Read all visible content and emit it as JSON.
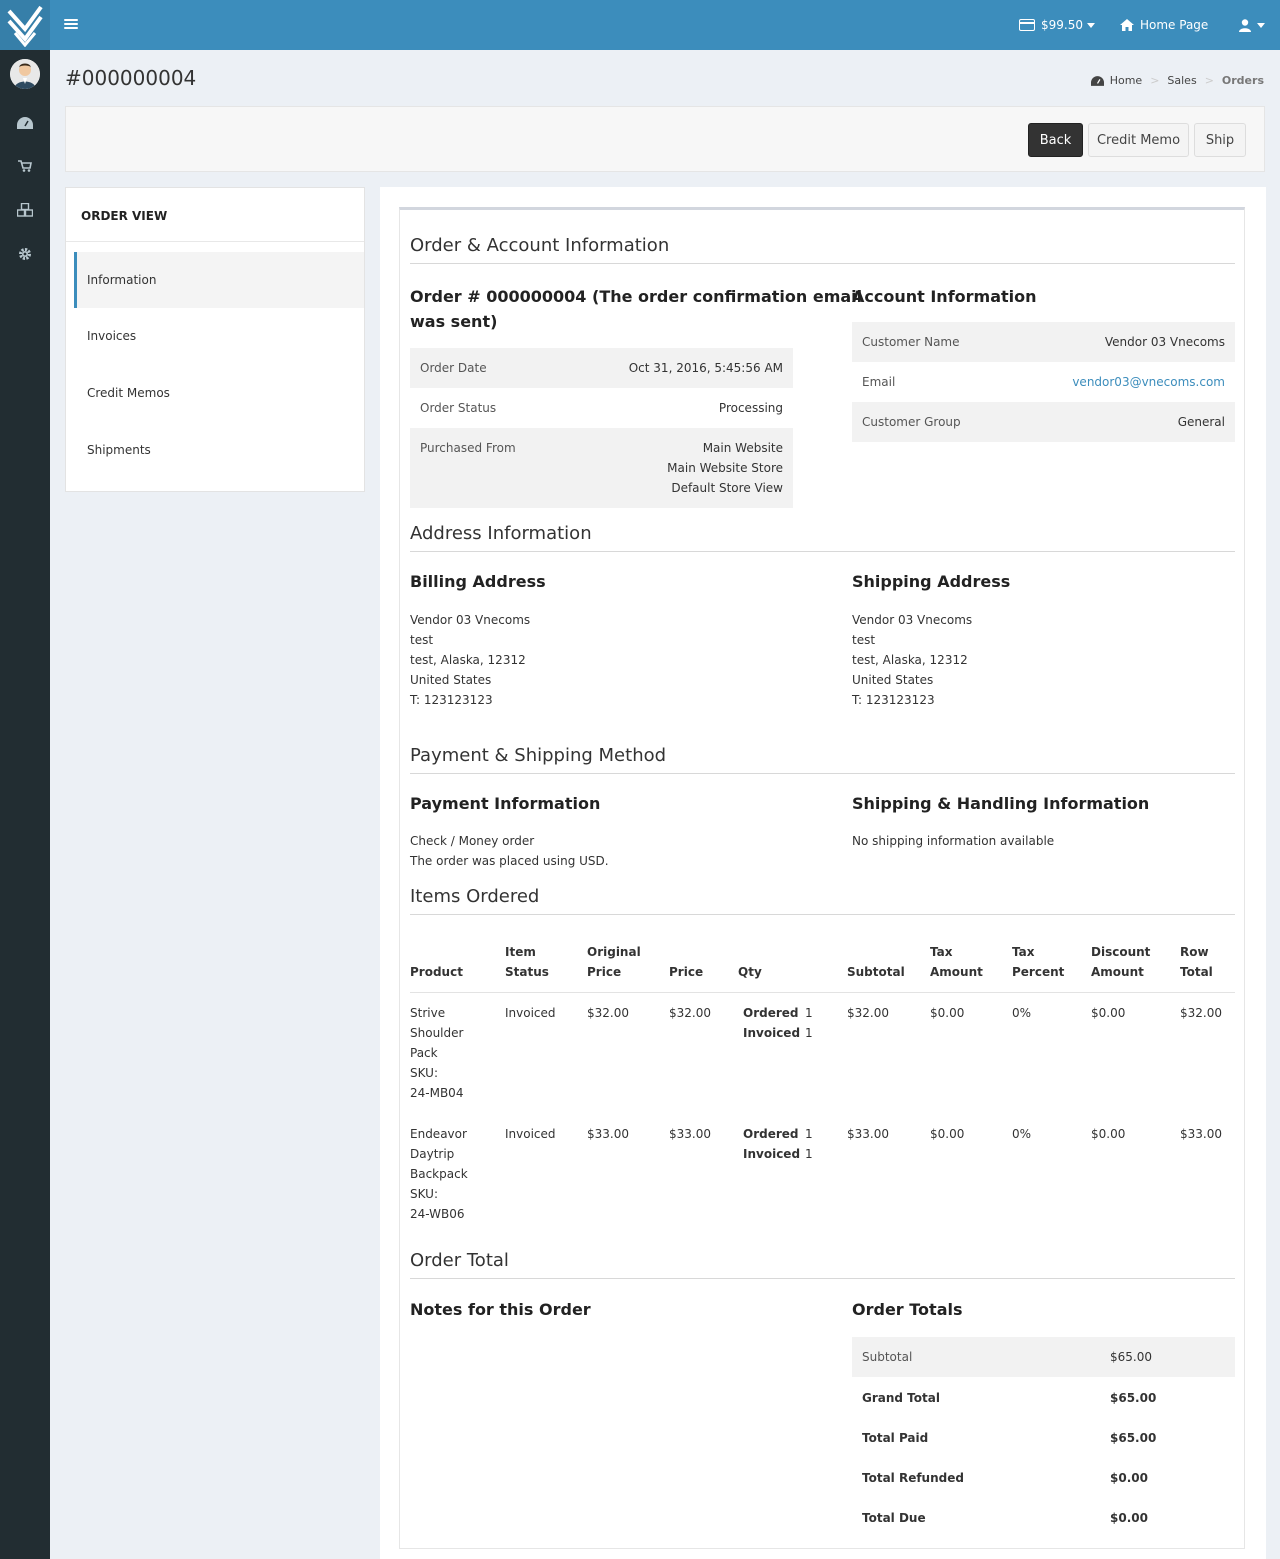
{
  "topbar": {
    "balance": "$99.50",
    "home_page": "Home Page"
  },
  "header": {
    "title": "#000000004",
    "breadcrumb": [
      "Home",
      "Sales",
      "Orders"
    ]
  },
  "toolbar": {
    "back": "Back",
    "credit_memo": "Credit Memo",
    "ship": "Ship"
  },
  "order_menu": {
    "title": "ORDER VIEW",
    "items": [
      "Information",
      "Invoices",
      "Credit Memos",
      "Shipments"
    ]
  },
  "order_account": {
    "section_title": "Order & Account Information",
    "order_heading_line1": "Order # 000000004 (The order confirmation email",
    "order_heading_line2": "was sent)",
    "order_date_label": "Order Date",
    "order_date": "Oct 31, 2016, 5:45:56 AM",
    "order_status_label": "Order Status",
    "order_status": "Processing",
    "purchased_from_label": "Purchased From",
    "purchased_from": [
      "Main Website",
      "Main Website Store",
      "Default Store View"
    ],
    "account_heading": "Account Information",
    "customer_name_label": "Customer Name",
    "customer_name": "Vendor 03 Vnecoms",
    "email_label": "Email",
    "email": "vendor03@vnecoms.com",
    "customer_group_label": "Customer Group",
    "customer_group": "General"
  },
  "address": {
    "section_title": "Address Information",
    "billing_heading": "Billing Address",
    "billing_lines": [
      "Vendor 03 Vnecoms",
      "test",
      "test, Alaska, 12312",
      "United States",
      "T: 123123123"
    ],
    "shipping_heading": "Shipping Address",
    "shipping_lines": [
      "Vendor 03 Vnecoms",
      "test",
      "test, Alaska, 12312",
      "United States",
      "T: 123123123"
    ]
  },
  "payment_shipping": {
    "section_title": "Payment & Shipping Method",
    "payment_heading": "Payment Information",
    "payment_lines": [
      "Check / Money order",
      "The order was placed using USD."
    ],
    "shipping_heading": "Shipping & Handling Information",
    "shipping_text": "No shipping information available"
  },
  "items": {
    "section_title": "Items Ordered",
    "headers": {
      "product": "Product",
      "item_status": [
        "Item",
        "Status"
      ],
      "original_price": [
        "Original",
        "Price"
      ],
      "price": "Price",
      "qty": "Qty",
      "subtotal": "Subtotal",
      "tax_amount": [
        "Tax",
        "Amount"
      ],
      "tax_percent": [
        "Tax",
        "Percent"
      ],
      "discount_amount": [
        "Discount",
        "Amount"
      ],
      "row_total": [
        "Row",
        "Total"
      ]
    },
    "qty_ordered_label": "Ordered",
    "qty_invoiced_label": "Invoiced",
    "rows": [
      {
        "product_lines": [
          "Strive",
          "Shoulder",
          "Pack",
          "SKU:",
          "24-MB04"
        ],
        "status": "Invoiced",
        "original_price": "$32.00",
        "price": "$32.00",
        "qty_ordered": "1",
        "qty_invoiced": "1",
        "subtotal": "$32.00",
        "tax_amount": "$0.00",
        "tax_percent": "0%",
        "discount": "$0.00",
        "row_total": "$32.00"
      },
      {
        "product_lines": [
          "Endeavor",
          "Daytrip",
          "Backpack",
          "SKU:",
          "24-WB06"
        ],
        "status": "Invoiced",
        "original_price": "$33.00",
        "price": "$33.00",
        "qty_ordered": "1",
        "qty_invoiced": "1",
        "subtotal": "$33.00",
        "tax_amount": "$0.00",
        "tax_percent": "0%",
        "discount": "$0.00",
        "row_total": "$33.00"
      }
    ]
  },
  "order_total": {
    "section_title": "Order Total",
    "notes_heading": "Notes for this Order",
    "totals_heading": "Order Totals",
    "rows": [
      {
        "label": "Subtotal",
        "value": "$65.00"
      },
      {
        "label": "Grand Total",
        "value": "$65.00"
      },
      {
        "label": "Total Paid",
        "value": "$65.00"
      },
      {
        "label": "Total Refunded",
        "value": "$0.00"
      },
      {
        "label": "Total Due",
        "value": "$0.00"
      }
    ]
  },
  "colors": {
    "topbar": "#3c8dbc",
    "sidebar": "#222d32",
    "link": "#3c8dbc",
    "dark_button": "#333333"
  }
}
